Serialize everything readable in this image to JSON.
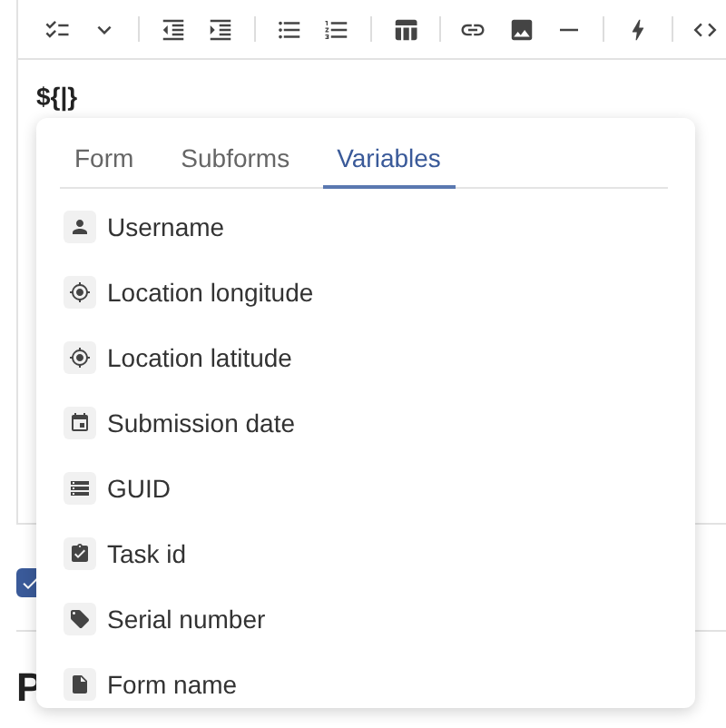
{
  "editor": {
    "text": "${|}"
  },
  "variable_menu": {
    "tabs": [
      {
        "label": "Form",
        "selected": false
      },
      {
        "label": "Subforms",
        "selected": false
      },
      {
        "label": "Variables",
        "selected": true
      }
    ],
    "items": [
      {
        "label": "Username",
        "kind": "user"
      },
      {
        "label": "Location longitude",
        "kind": "location"
      },
      {
        "label": "Location latitude",
        "kind": "location"
      },
      {
        "label": "Submission date",
        "kind": "date"
      },
      {
        "label": "GUID",
        "kind": "guid"
      },
      {
        "label": "Task id",
        "kind": "task"
      },
      {
        "label": "Serial number",
        "kind": "serial"
      },
      {
        "label": "Form name",
        "kind": "form"
      }
    ]
  },
  "option_checkbox": {
    "checked": true
  },
  "section_heading": "P"
}
